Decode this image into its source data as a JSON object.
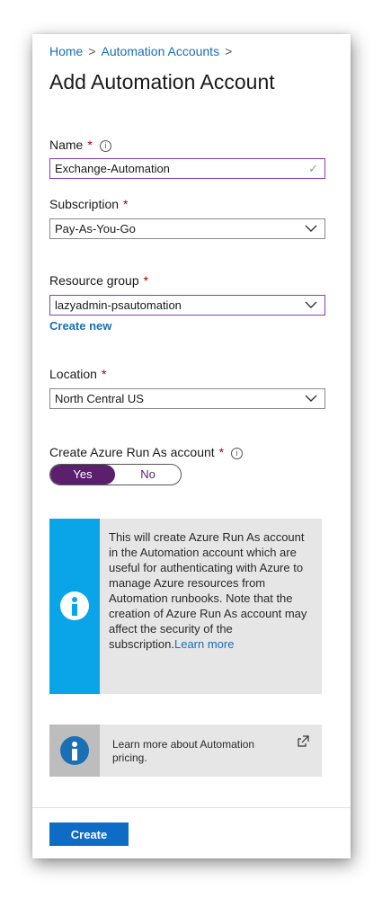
{
  "breadcrumb": {
    "items": [
      {
        "label": "Home"
      },
      {
        "label": "Automation Accounts"
      }
    ],
    "separator": ">"
  },
  "page_title": "Add Automation Account",
  "form": {
    "name": {
      "label": "Name",
      "required_mark": "*",
      "value": "Exchange-Automation"
    },
    "subscription": {
      "label": "Subscription",
      "required_mark": "*",
      "value": "Pay-As-You-Go"
    },
    "resource_group": {
      "label": "Resource group",
      "required_mark": "*",
      "value": "lazyadmin-psautomation",
      "create_new_label": "Create new"
    },
    "location": {
      "label": "Location",
      "required_mark": "*",
      "value": "North Central US"
    },
    "run_as": {
      "label": "Create Azure Run As account",
      "required_mark": "*",
      "yes_label": "Yes",
      "no_label": "No",
      "selected": "Yes"
    }
  },
  "info_box": {
    "text": "This will create Azure Run As account in the Automation account which are useful for authenticating with Azure to manage Azure resources from Automation runbooks. Note that the creation of Azure Run As account may affect the security of the subscription.",
    "link_label": "Learn more"
  },
  "pricing_box": {
    "text": "Learn more about Automation pricing."
  },
  "footer": {
    "create_label": "Create"
  },
  "colors": {
    "accent": "#0f6cc6",
    "link": "#1a6fb5",
    "toggle_selected": "#5b1f6e",
    "focus_border": "#8a3db8",
    "info_stripe": "#0aa5e8",
    "required": "#a80000"
  },
  "icons": {
    "info_tooltip": "info-circle-icon",
    "valid": "checkmark-icon",
    "dropdown": "chevron-down-icon",
    "info_banner": "info-icon",
    "external_link": "external-link-icon"
  }
}
